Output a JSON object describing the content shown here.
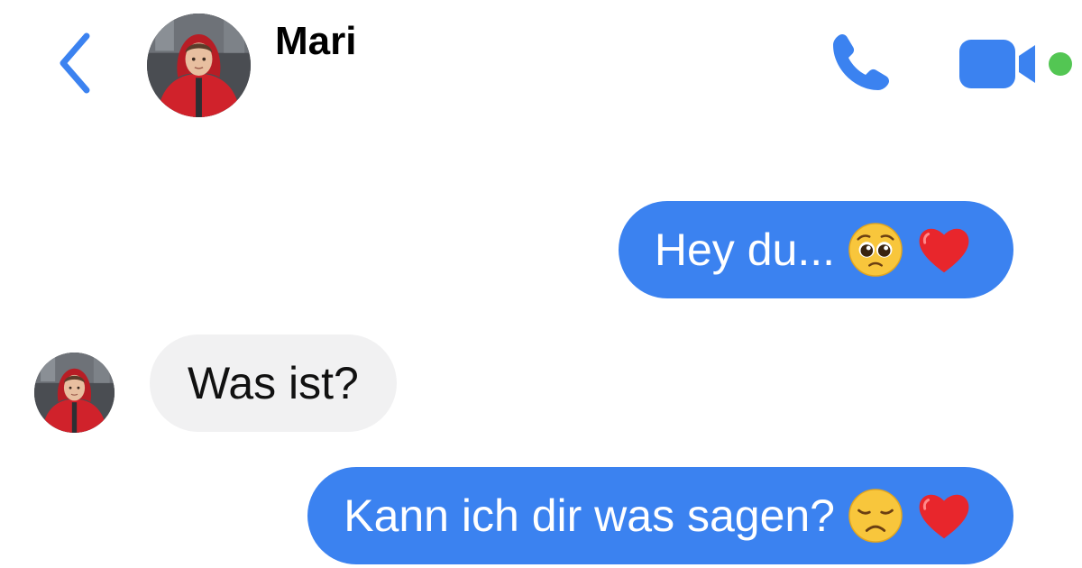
{
  "header": {
    "contact_name": "Mari",
    "icons": {
      "back": "chevron-left-icon",
      "call": "phone-icon",
      "video": "video-camera-icon",
      "status": "online-status-dot"
    },
    "accent_color": "#3b82f0",
    "online_color": "#53c653"
  },
  "messages": [
    {
      "direction": "outgoing",
      "text": "Hey du...",
      "emojis": [
        "pleading-face-emoji",
        "red-heart-emoji"
      ]
    },
    {
      "direction": "incoming",
      "text": "Was ist?",
      "emojis": []
    },
    {
      "direction": "outgoing",
      "text": "Kann ich dir was sagen?",
      "emojis": [
        "disappointed-face-emoji",
        "red-heart-emoji"
      ]
    }
  ],
  "colors": {
    "outgoing_bubble": "#3b82f0",
    "incoming_bubble": "#f1f1f2",
    "background": "#ffffff"
  }
}
